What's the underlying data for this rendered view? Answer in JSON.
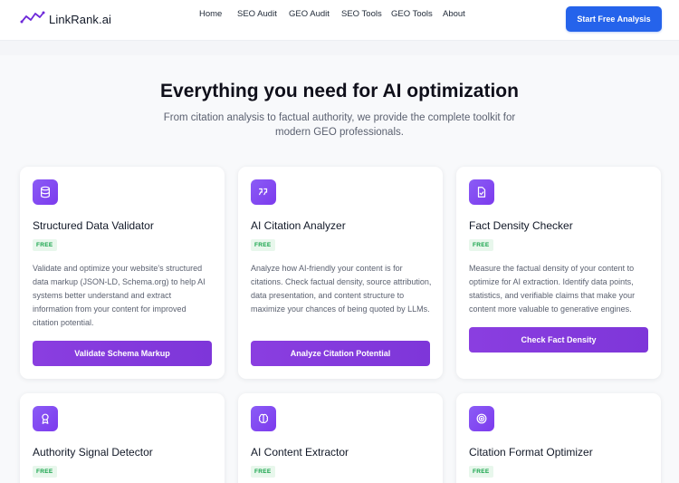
{
  "header": {
    "logo_text": "LinkRank.ai",
    "nav": [
      "Home",
      "SEO Audit",
      "GEO Audit",
      "SEO Tools",
      "GEO Tools",
      "About"
    ],
    "cta_label": "Start Free Analysis"
  },
  "hero": {
    "title": "Everything you need for AI optimization",
    "subtitle": "From citation analysis to factual authority, we provide the complete toolkit for modern GEO professionals."
  },
  "cards": [
    {
      "icon": "database-icon",
      "title": "Structured Data Validator",
      "badge": "FREE",
      "description": "Validate and optimize your website's structured data markup (JSON-LD, Schema.org) to help AI systems better understand and extract information from your content for improved citation potential.",
      "button": "Validate Schema Markup"
    },
    {
      "icon": "quote-icon",
      "title": "AI Citation Analyzer",
      "badge": "FREE",
      "description": "Analyze how AI-friendly your content is for citations. Check factual density, source attribution, data presentation, and content structure to maximize your chances of being quoted by LLMs.",
      "button": "Analyze Citation Potential"
    },
    {
      "icon": "document-check-icon",
      "title": "Fact Density Checker",
      "badge": "FREE",
      "description": "Measure the factual density of your content to optimize for AI extraction. Identify data points, statistics, and verifiable claims that make your content more valuable to generative engines.",
      "button": "Check Fact Density"
    },
    {
      "icon": "award-icon",
      "title": "Authority Signal Detector",
      "badge": "FREE"
    },
    {
      "icon": "brain-icon",
      "title": "AI Content Extractor",
      "badge": "FREE"
    },
    {
      "icon": "target-icon",
      "title": "Citation Format Optimizer",
      "badge": "FREE"
    }
  ],
  "colors": {
    "primary_blue": "#2563eb",
    "accent_purple": "#8b3cdf",
    "badge_green": "#16a34a"
  }
}
